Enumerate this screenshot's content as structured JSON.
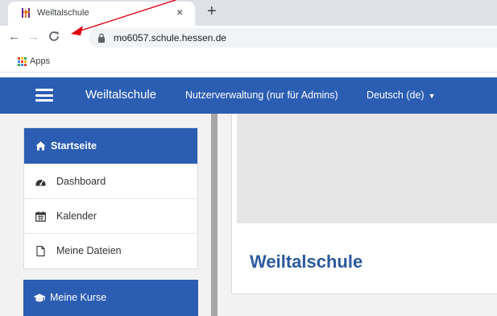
{
  "browser": {
    "tab": {
      "title": "Weiltalschule",
      "close_glyph": "×",
      "favicon": "moodle-favicon-icon"
    },
    "new_tab_glyph": "+",
    "nav": {
      "back": "←",
      "forward": "→"
    },
    "url": "mo6057.schule.hessen.de",
    "bookmarks": {
      "apps_label": "Apps"
    }
  },
  "navbar": {
    "site_name": "Weiltalschule",
    "user_management": "Nutzerverwaltung (nur für Admins)",
    "language": "Deutsch (de)",
    "color": "#2b5db3"
  },
  "sidebar": {
    "home_block": {
      "title": "Startseite",
      "icon": "home-icon",
      "items": [
        {
          "label": "Dashboard",
          "icon": "dashboard-icon"
        },
        {
          "label": "Kalender",
          "icon": "calendar-icon"
        },
        {
          "label": "Meine Dateien",
          "icon": "file-icon"
        }
      ]
    },
    "courses_block": {
      "title": "Meine Kurse",
      "icon": "graduation-cap-icon"
    }
  },
  "main": {
    "title": "Weiltalschule",
    "title_color": "#2b5a9e"
  },
  "annotation": {
    "color": "#e0000f"
  }
}
